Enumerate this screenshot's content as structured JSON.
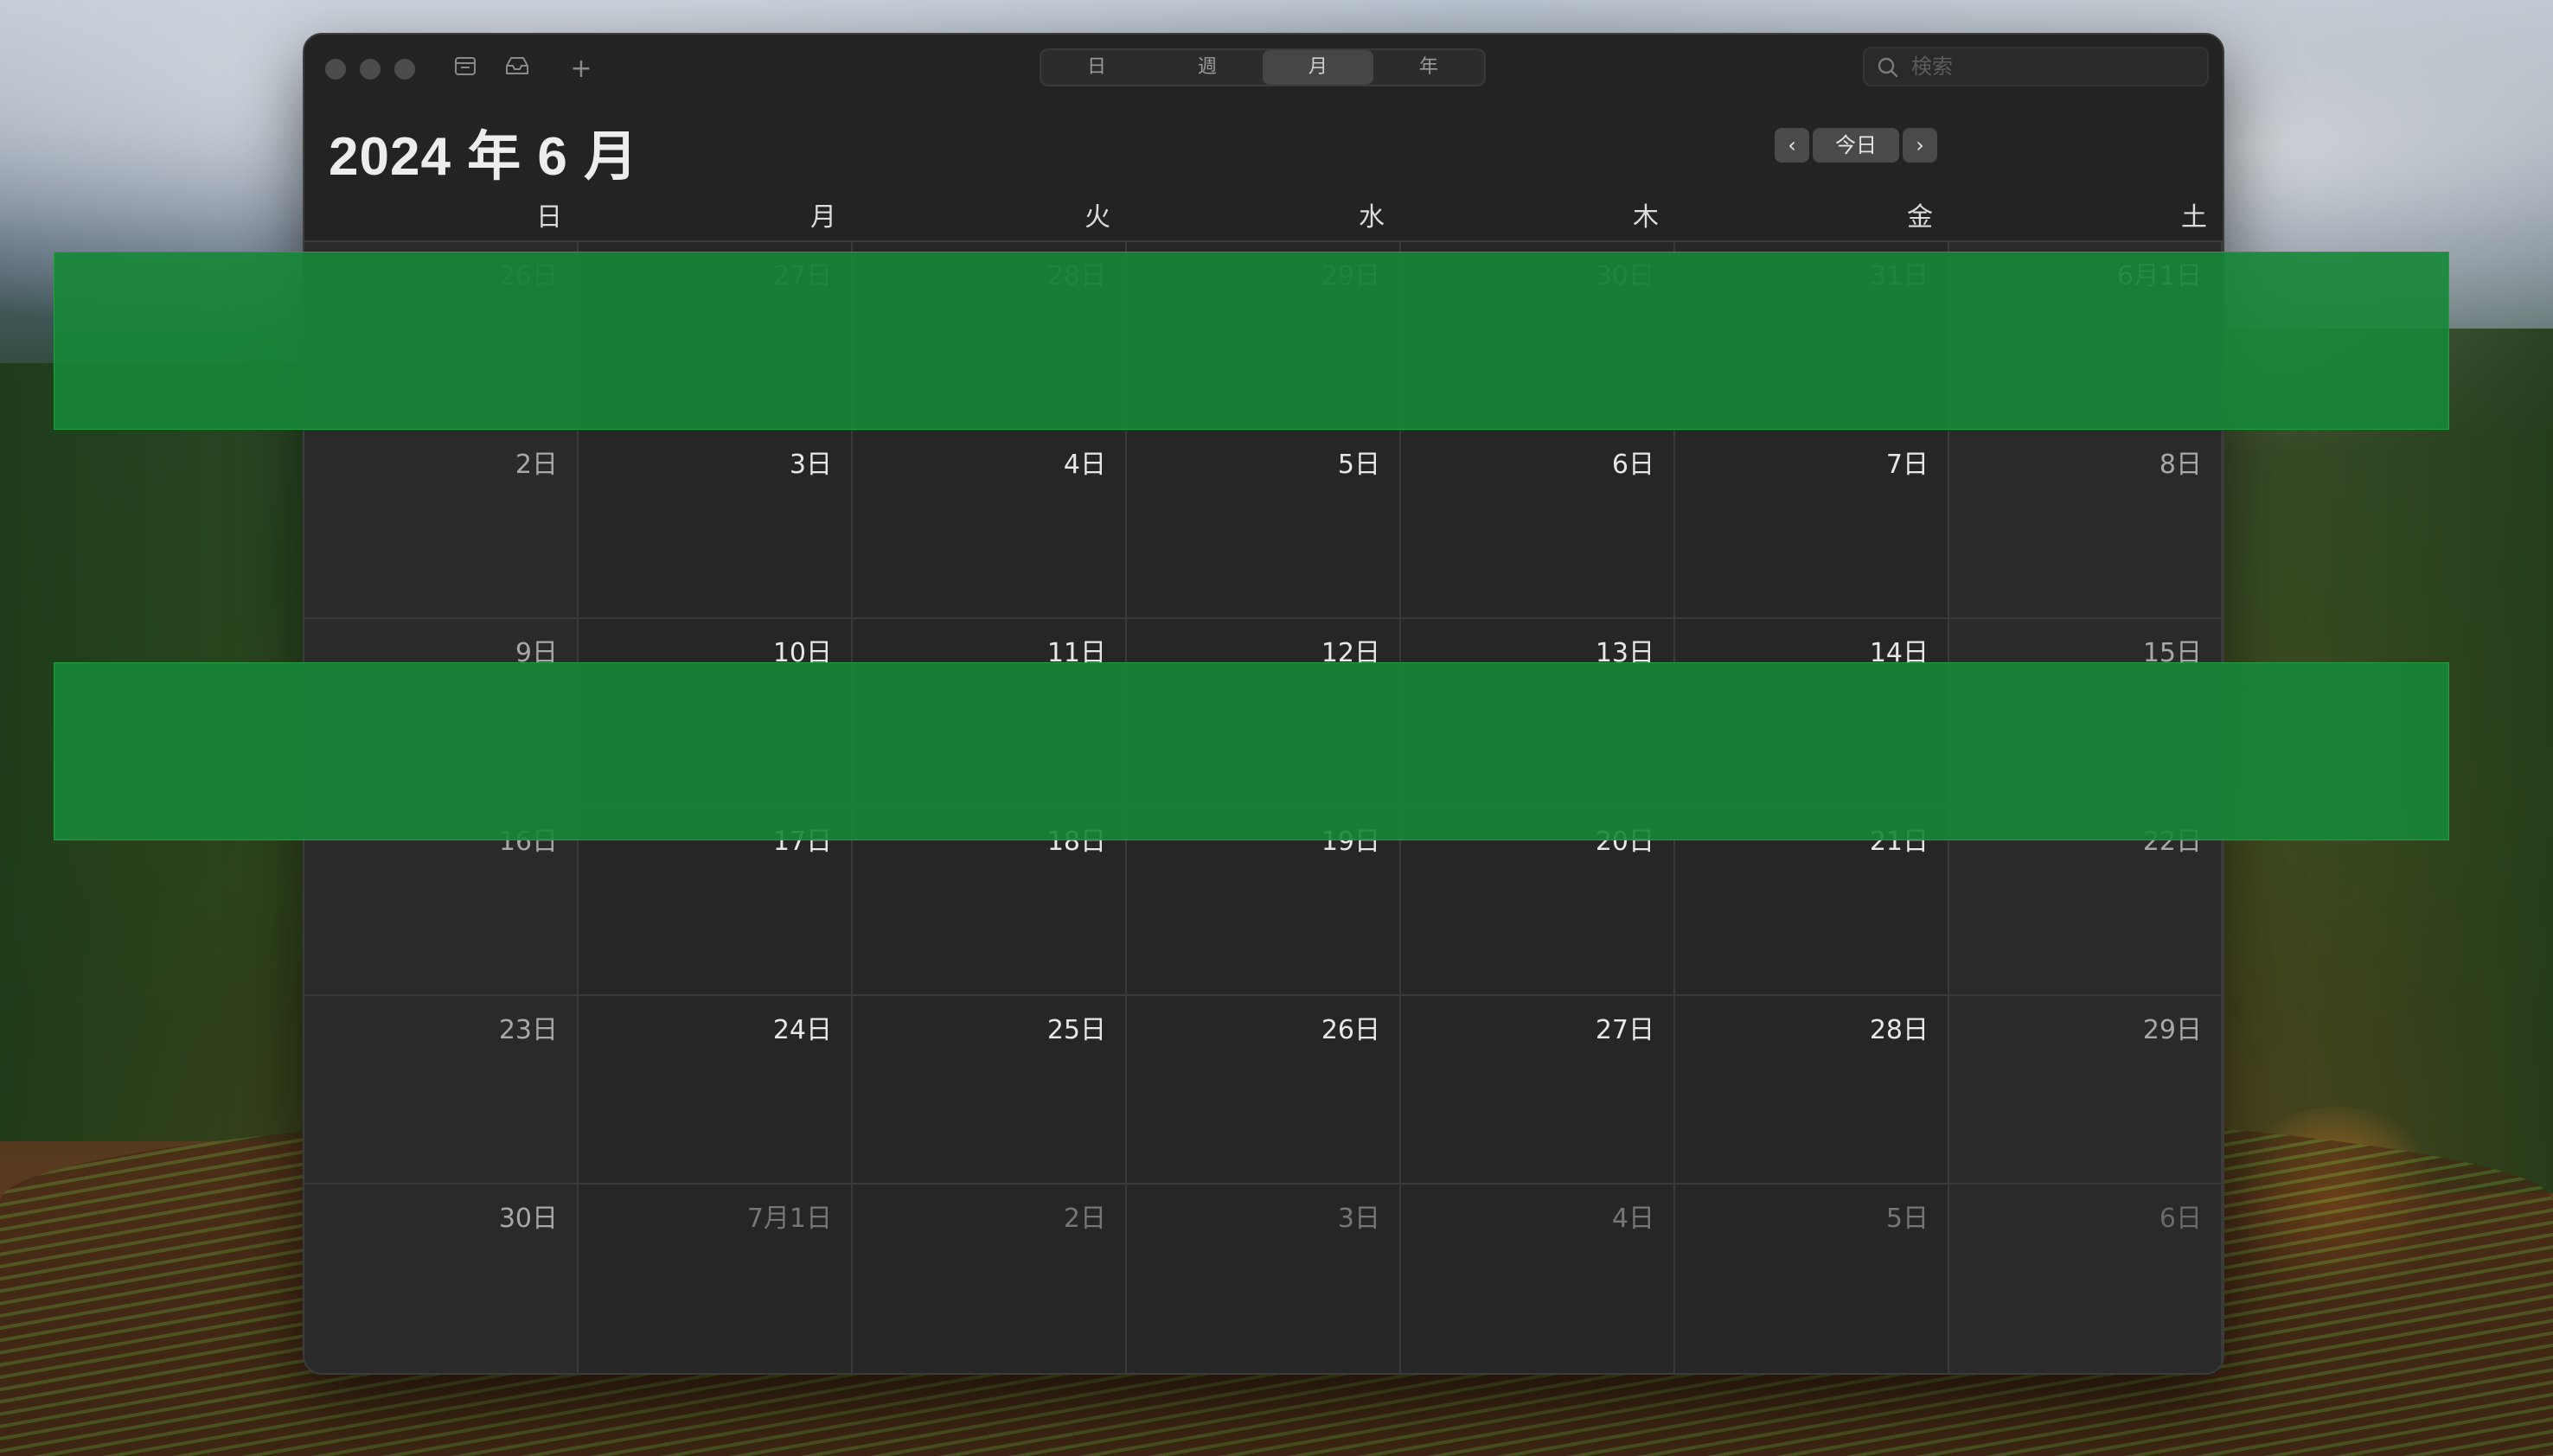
{
  "window": {
    "toolbar": {
      "calendars_icon": "calendar-list-icon",
      "inbox_icon": "inbox-icon",
      "add_icon": "plus-icon",
      "add_symbol": "+"
    },
    "view_tabs": [
      {
        "label": "日",
        "active": false
      },
      {
        "label": "週",
        "active": false
      },
      {
        "label": "月",
        "active": true
      },
      {
        "label": "年",
        "active": false
      }
    ],
    "search": {
      "placeholder": "検索"
    },
    "title": "2024 年 6 月",
    "nav": {
      "prev": "‹",
      "today": "今日",
      "next": "›"
    }
  },
  "weekdays": [
    "日",
    "月",
    "火",
    "水",
    "木",
    "金",
    "土"
  ],
  "weeks": [
    [
      {
        "label": "26日",
        "dim": true
      },
      {
        "label": "27日",
        "dim": true
      },
      {
        "label": "28日",
        "dim": true
      },
      {
        "label": "29日",
        "dim": true
      },
      {
        "label": "30日",
        "dim": true
      },
      {
        "label": "31日",
        "dim": true
      },
      {
        "label": "6月1日",
        "dim": false
      }
    ],
    [
      {
        "label": "2日",
        "dim": false
      },
      {
        "label": "3日",
        "dim": false
      },
      {
        "label": "4日",
        "dim": false
      },
      {
        "label": "5日",
        "dim": false
      },
      {
        "label": "6日",
        "dim": false
      },
      {
        "label": "7日",
        "dim": false
      },
      {
        "label": "8日",
        "dim": false
      }
    ],
    [
      {
        "label": "9日",
        "dim": false
      },
      {
        "label": "10日",
        "dim": false
      },
      {
        "label": "11日",
        "dim": false
      },
      {
        "label": "12日",
        "dim": false
      },
      {
        "label": "13日",
        "dim": false
      },
      {
        "label": "14日",
        "dim": false
      },
      {
        "label": "15日",
        "dim": false
      }
    ],
    [
      {
        "label": "16日",
        "dim": false
      },
      {
        "label": "17日",
        "dim": false
      },
      {
        "label": "18日",
        "dim": false
      },
      {
        "label": "19日",
        "dim": false
      },
      {
        "label": "20日",
        "dim": false
      },
      {
        "label": "21日",
        "dim": false
      },
      {
        "label": "22日",
        "dim": false
      }
    ],
    [
      {
        "label": "23日",
        "dim": false
      },
      {
        "label": "24日",
        "dim": false
      },
      {
        "label": "25日",
        "dim": false
      },
      {
        "label": "26日",
        "dim": false
      },
      {
        "label": "27日",
        "dim": false
      },
      {
        "label": "28日",
        "dim": false
      },
      {
        "label": "29日",
        "dim": false
      }
    ],
    [
      {
        "label": "30日",
        "dim": false
      },
      {
        "label": "7月1日",
        "dim": true
      },
      {
        "label": "2日",
        "dim": true
      },
      {
        "label": "3日",
        "dim": true
      },
      {
        "label": "4日",
        "dim": true
      },
      {
        "label": "5日",
        "dim": true
      },
      {
        "label": "6日",
        "dim": true
      }
    ]
  ],
  "highlight_color": "#168737"
}
